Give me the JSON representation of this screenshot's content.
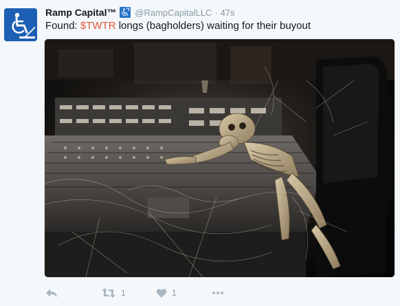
{
  "tweet": {
    "display_name": "Ramp Capital™",
    "handle": "@RampCapitalLLC",
    "separator": "·",
    "timestamp": "47s",
    "text_prefix": "Found: ",
    "cashtag": "$TWTR",
    "text_suffix": " longs (bagholders) waiting for their buyout",
    "avatar_icon": "wheelchair-icon",
    "badge_icon": "wheelchair-badge-icon",
    "photo_description_icon": "skeleton-photo"
  },
  "actions": {
    "reply_icon": "reply-icon",
    "retweet_icon": "retweet-icon",
    "retweet_count": "1",
    "like_icon": "heart-icon",
    "like_count": "1",
    "more_icon": "more-dots-icon"
  },
  "colors": {
    "background": "#f5f8fa",
    "cashtag": "#e0563a",
    "avatar_bg": "#1d5fb4",
    "muted": "#8899a6",
    "action_icon": "#aab8c2"
  }
}
